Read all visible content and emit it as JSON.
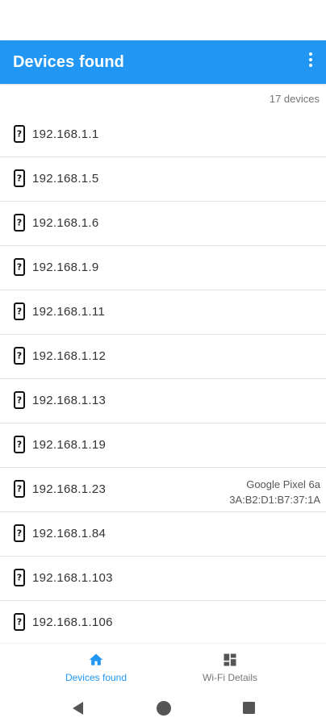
{
  "app_bar": {
    "title": "Devices found",
    "menu_icon": "more-vert-icon"
  },
  "summary": {
    "count_text": "17 devices"
  },
  "devices": [
    {
      "ip": "192.168.1.1",
      "name": "",
      "mac": ""
    },
    {
      "ip": "192.168.1.5",
      "name": "",
      "mac": ""
    },
    {
      "ip": "192.168.1.6",
      "name": "",
      "mac": ""
    },
    {
      "ip": "192.168.1.9",
      "name": "",
      "mac": ""
    },
    {
      "ip": "192.168.1.11",
      "name": "",
      "mac": ""
    },
    {
      "ip": "192.168.1.12",
      "name": "",
      "mac": ""
    },
    {
      "ip": "192.168.1.13",
      "name": "",
      "mac": ""
    },
    {
      "ip": "192.168.1.19",
      "name": "",
      "mac": ""
    },
    {
      "ip": "192.168.1.23",
      "name": "Google Pixel 6a",
      "mac": "3A:B2:D1:B7:37:1A"
    },
    {
      "ip": "192.168.1.84",
      "name": "",
      "mac": ""
    },
    {
      "ip": "192.168.1.103",
      "name": "",
      "mac": ""
    },
    {
      "ip": "192.168.1.106",
      "name": "",
      "mac": ""
    }
  ],
  "device_icon": "unknown-phone-icon",
  "bottom_nav": {
    "items": [
      {
        "label": "Devices found",
        "icon": "home-icon",
        "active": true
      },
      {
        "label": "Wi-Fi Details",
        "icon": "dashboard-icon",
        "active": false
      }
    ]
  },
  "colors": {
    "primary": "#2196f3",
    "divider": "#e3e3e3"
  }
}
